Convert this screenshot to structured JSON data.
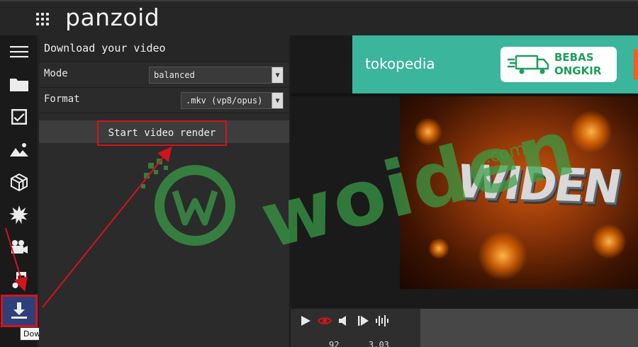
{
  "app": {
    "logo": "panzoid"
  },
  "sidebar": {
    "items": [
      {
        "icon": "menu-icon"
      },
      {
        "icon": "folder-icon"
      },
      {
        "icon": "checkbox-icon"
      },
      {
        "icon": "image-icon"
      },
      {
        "icon": "cube-icon"
      },
      {
        "icon": "burst-icon"
      },
      {
        "icon": "camera-icon"
      },
      {
        "icon": "music-icon"
      },
      {
        "icon": "download-icon",
        "active": true
      }
    ],
    "tooltip": "Download"
  },
  "panel": {
    "title": "Download your video",
    "mode": {
      "label": "Mode",
      "value": "balanced"
    },
    "format": {
      "label": "Format",
      "value": ".mkv (vp8/opus)"
    },
    "render_button": "Start video render"
  },
  "ad": {
    "brand": "tokopedia",
    "badge_line1": "BEBAS",
    "badge_line2": "ONGKIR"
  },
  "preview": {
    "video_text": "WIDEN"
  },
  "player": {
    "time_left": "92",
    "time_right": "3.03"
  },
  "watermark": {
    "text": "woiden",
    "suffix": ".com"
  },
  "colors": {
    "accent_active": "#2f3f7a",
    "highlight_red": "#d4141c",
    "ad_green": "#3bb59b",
    "watermark_green": "#3a9e46"
  }
}
